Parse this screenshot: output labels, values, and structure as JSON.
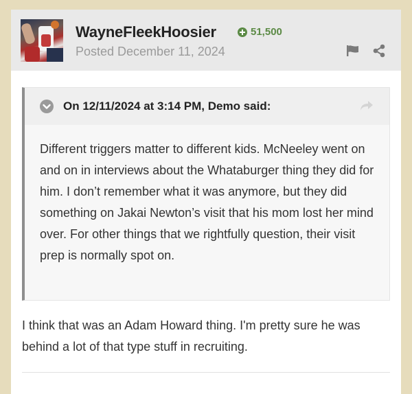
{
  "post": {
    "author": {
      "name": "WayneFleekHoosier",
      "reputation": "51,500",
      "posted": "Posted December 11, 2024"
    },
    "header_icons": [
      "flag-icon",
      "share-icon"
    ],
    "quote": {
      "citation": "On 12/11/2024 at 3:14 PM, Demo said:",
      "body": "Different triggers matter to different kids. McNeeley went on and on in interviews about the Whataburger thing they did for him. I don’t remember what it was anymore, but they did something on Jakai Newton’s visit that his mom lost her mind over. For other things that we rightfully question, their visit prep is normally spot on."
    },
    "reply": "I think that was an Adam Howard thing.  I'm pretty sure he was behind a lot of that type stuff in recruiting."
  },
  "colors": {
    "page_background": "#e6dcbc",
    "header_background": "#e9e9e9",
    "reputation_green": "#5b8a45",
    "quote_border": "#8e8e8e"
  }
}
